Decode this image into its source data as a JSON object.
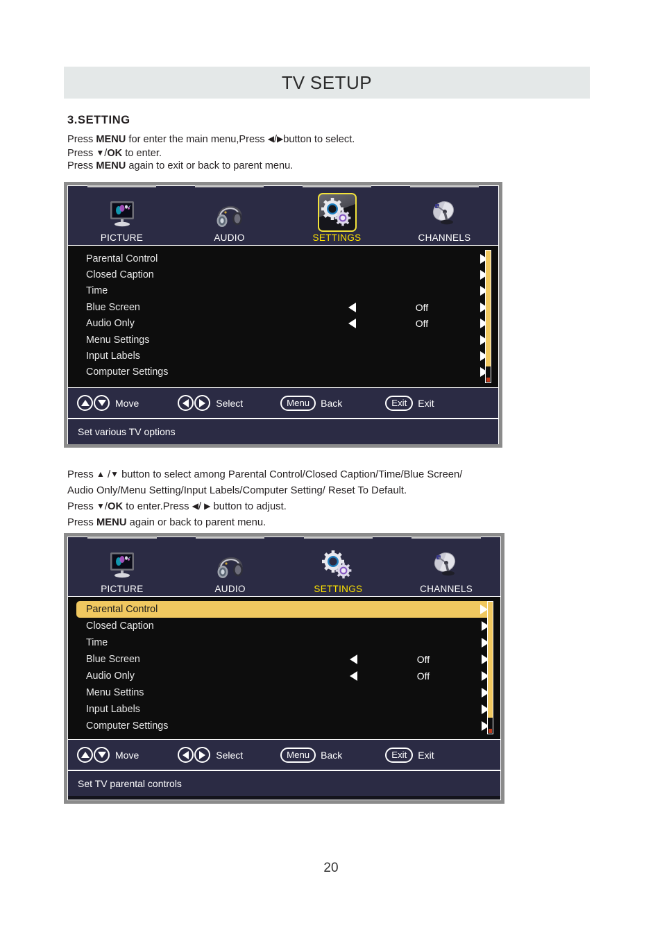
{
  "header": {
    "title_part1": "TV",
    "title_part2": "SETUP"
  },
  "section": {
    "heading": "3.SETTING",
    "intro_line1_a": "Press ",
    "intro_line1_menu": "MENU",
    "intro_line1_b": " for  enter the main menu,Press ",
    "intro_line1_c": "button  to select.",
    "intro_line2_a": "Press ",
    "intro_line2_ok": "OK",
    "intro_line2_b": " to enter.",
    "intro_line3_a": "Press  ",
    "intro_line3_menu": "MENU",
    "intro_line3_b": "  again  to exit or back to parent menu."
  },
  "mid_paragraph": {
    "line1_a": "Press ",
    "line1_b": " button to select among Parental Control/Closed Caption/Time/Blue Screen/",
    "line2": "Audio Only/Menu Setting/Input Labels/Computer Setting/ Reset To Default.",
    "line3_a": "Press ",
    "line3_ok": "OK",
    "line3_b": " to enter.Press ",
    "line3_c": " button  to adjust.",
    "line4_a": "Press  ",
    "line4_menu": "MENU",
    "line4_b": " again or back to parent menu."
  },
  "osd_tabs": [
    {
      "label": "PICTURE",
      "icon": "monitor-icon",
      "active": false
    },
    {
      "label": "AUDIO",
      "icon": "headphones-icon",
      "active": false
    },
    {
      "label": "SETTINGS",
      "icon": "gears-icon",
      "active": true
    },
    {
      "label": "CHANNELS",
      "icon": "satellite-dish-icon",
      "active": false
    }
  ],
  "panel1": {
    "rows": [
      {
        "label": "Parental Control",
        "value": "",
        "left_arrow": false,
        "right_arrow": true,
        "highlighted": false
      },
      {
        "label": "Closed Caption",
        "value": "",
        "left_arrow": false,
        "right_arrow": true,
        "highlighted": false
      },
      {
        "label": "Time",
        "value": "",
        "left_arrow": false,
        "right_arrow": true,
        "highlighted": false
      },
      {
        "label": "Blue Screen",
        "value": "Off",
        "left_arrow": true,
        "right_arrow": true,
        "highlighted": false
      },
      {
        "label": "Audio Only",
        "value": "Off",
        "left_arrow": true,
        "right_arrow": true,
        "highlighted": false
      },
      {
        "label": "Menu Settings",
        "value": "",
        "left_arrow": false,
        "right_arrow": true,
        "highlighted": false
      },
      {
        "label": "Input Labels",
        "value": "",
        "left_arrow": false,
        "right_arrow": true,
        "highlighted": false
      },
      {
        "label": "Computer Settings",
        "value": "",
        "left_arrow": false,
        "right_arrow": true,
        "highlighted": false
      }
    ],
    "hints": [
      {
        "label": "Move",
        "button": "updown"
      },
      {
        "label": "Select",
        "button": "leftright"
      },
      {
        "label": "Back",
        "button": "Menu"
      },
      {
        "label": "Exit",
        "button": "Exit"
      }
    ],
    "description": "Set various TV options",
    "settings_tab_boxed": true
  },
  "panel2": {
    "rows": [
      {
        "label": "Parental Control",
        "value": "",
        "left_arrow": false,
        "right_arrow": true,
        "highlighted": true
      },
      {
        "label": "Closed Caption",
        "value": "",
        "left_arrow": false,
        "right_arrow": true,
        "highlighted": false
      },
      {
        "label": "Time",
        "value": "",
        "left_arrow": false,
        "right_arrow": true,
        "highlighted": false
      },
      {
        "label": "Blue Screen",
        "value": "Off",
        "left_arrow": true,
        "right_arrow": true,
        "highlighted": false
      },
      {
        "label": "Audio Only",
        "value": "Off",
        "left_arrow": true,
        "right_arrow": true,
        "highlighted": false
      },
      {
        "label": "Menu Settins",
        "value": "",
        "left_arrow": false,
        "right_arrow": true,
        "highlighted": false
      },
      {
        "label": "Input Labels",
        "value": "",
        "left_arrow": false,
        "right_arrow": true,
        "highlighted": false
      },
      {
        "label": "Computer Settings",
        "value": "",
        "left_arrow": false,
        "right_arrow": true,
        "highlighted": false
      }
    ],
    "hints": [
      {
        "label": "Move",
        "button": "updown"
      },
      {
        "label": "Select",
        "button": "leftright"
      },
      {
        "label": "Back",
        "button": "Menu"
      },
      {
        "label": "Exit",
        "button": "Exit"
      }
    ],
    "description": "Set TV parental controls",
    "settings_tab_boxed": false
  },
  "buttons": {
    "menu": "Menu",
    "exit": "Exit"
  },
  "page_number": "20",
  "colors": {
    "header_band": "#e4e8e8",
    "osd_tabbar": "#2b2b44",
    "osd_list": "#0d0d0d",
    "highlight": "#f0c860",
    "active_tab_text": "#ffe400",
    "scroll_thumb": "#f0c860",
    "scroll_mark": "#c03a1a"
  }
}
